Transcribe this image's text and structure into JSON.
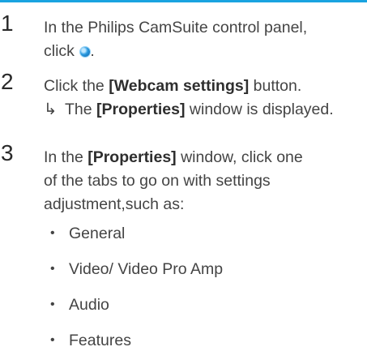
{
  "steps": [
    {
      "number": "1",
      "line1": "In the Philips CamSuite control panel,",
      "line2_prefix": "click ",
      "line2_suffix": ".",
      "icon": "camsuite-icon"
    },
    {
      "number": "2",
      "prefix": "Click the ",
      "bold": "[Webcam settings]",
      "suffix": " button.",
      "result_arrow": "↳",
      "result_prefix": "The ",
      "result_bold": "[Properties]",
      "result_suffix": " window is displayed."
    },
    {
      "number": "3",
      "prefix": "In the ",
      "bold": "[Properties]",
      "suffix": " window, click one",
      "line2": "of the tabs to go on with settings",
      "line3": "adjustment,such as:",
      "bullets": [
        "General",
        "Video/ Video Pro Amp",
        "Audio",
        "Features"
      ]
    }
  ]
}
